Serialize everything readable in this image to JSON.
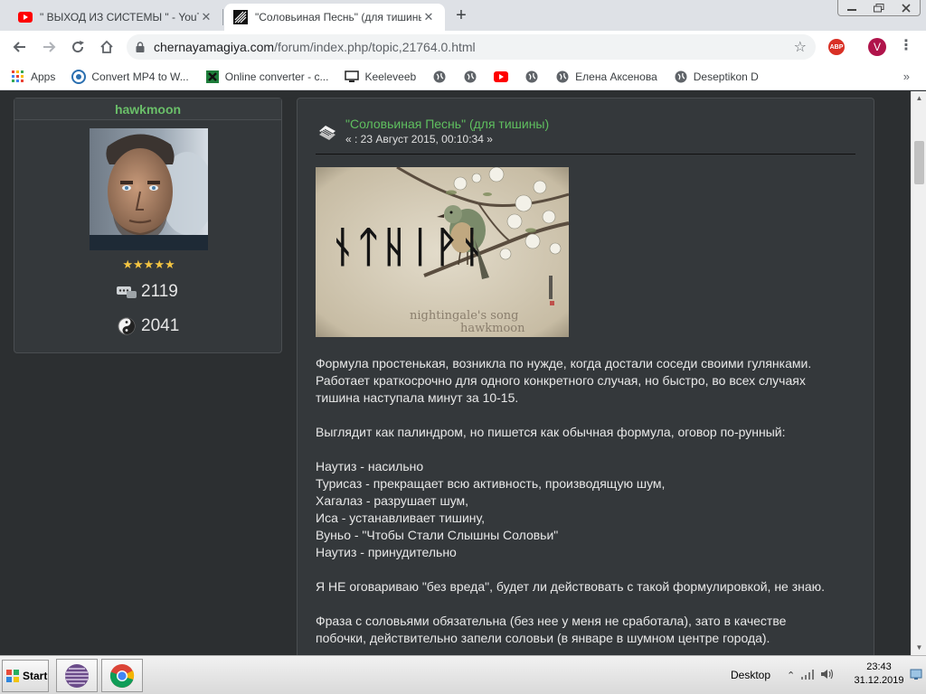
{
  "browser": {
    "tabs": [
      {
        "title": "\" ВЫХОД ИЗ СИСТЕМЫ \" - YouTube",
        "favicon": "youtube-icon",
        "active": false
      },
      {
        "title": "\"Соловьиная Песнь\" (для тишины)",
        "favicon": "forum-icon",
        "active": true
      }
    ],
    "url_host": "chernayamagiya.com",
    "url_path": "/forum/index.php/topic,21764.0.html",
    "abp_label": "ABP",
    "profile_initial": "V"
  },
  "bookmarks": [
    {
      "label": "Apps",
      "icon": "apps-grid-icon"
    },
    {
      "label": "Convert MP4 to W...",
      "icon": "convert-icon"
    },
    {
      "label": "Online converter - c...",
      "icon": "excel-icon"
    },
    {
      "label": "Keeleveeb",
      "icon": "computer-icon"
    },
    {
      "label": "",
      "icon": "globe-icon"
    },
    {
      "label": "",
      "icon": "globe-icon"
    },
    {
      "label": "",
      "icon": "youtube-icon"
    },
    {
      "label": "",
      "icon": "globe-icon"
    },
    {
      "label": "Елена Аксенова",
      "icon": "globe-icon"
    },
    {
      "label": "Deseptikon D",
      "icon": "globe-icon"
    }
  ],
  "poster": {
    "name": "hawkmoon",
    "stars": "★★★★★",
    "posts": "2119",
    "karma": "2041"
  },
  "post": {
    "title": "\"Соловьиная Песнь\" (для тишины)",
    "date": "« : 23 Август 2015, 00:10:34 »",
    "image": {
      "runes": "ᚾᛏᚺᛁᚹᚾ",
      "caption_line1": "nightingale's song",
      "caption_line2": "hawkmoon"
    },
    "paragraphs": [
      {
        "lines": [
          "Формула простенькая, возникла по нужде, когда достали соседи своими гулянками.",
          "Работает краткосрочно для одного конкретного случая, но быстро, во всех случаях",
          "тишина наступала минут за 10-15."
        ]
      },
      {
        "lines": [
          "Выглядит как палиндром, но пишется как обычная формула, оговор по-рунный:"
        ]
      },
      {
        "lines": [
          "Наутиз - насильно",
          "Турисаз - прекращает всю активность, производящую шум,",
          "Хагалаз - разрушает шум,",
          "Иса - устанавливает тишину,",
          "Вуньо - \"Чтобы Стали Слышны Соловьи\"",
          "Наутиз -  принудительно"
        ]
      },
      {
        "lines": [
          "Я НЕ оговариваю \"без вреда\", будет ли действовать с такой формулировкой, не знаю."
        ]
      },
      {
        "lines": [
          "Фраза с соловьями обязательна (без нее у меня не сработала), зато в качестве",
          "побочки, действительно запели соловьи (в январе в шумном центре города)."
        ]
      }
    ]
  },
  "taskbar": {
    "start_label": "Start",
    "desktop_label": "Desktop",
    "time": "23:43",
    "date": "31.12.2019"
  }
}
